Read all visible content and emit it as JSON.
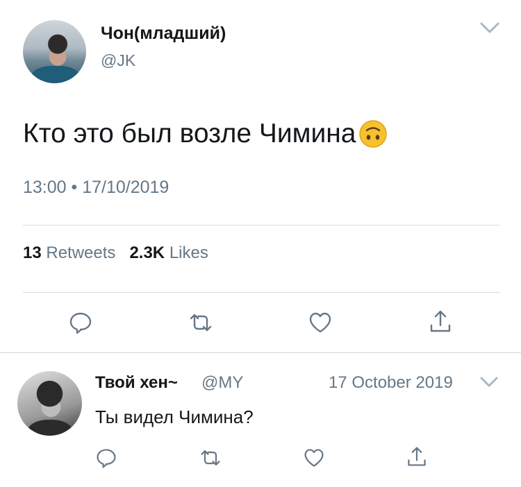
{
  "tweet": {
    "author_name": "Чон(младший)",
    "author_handle": "@JK",
    "text": "Кто это был возле Чимина",
    "emoji": "upside-down-face-icon",
    "meta": "13:00 • 17/10/2019",
    "retweets_count": "13",
    "retweets_label": "Retweets",
    "likes_count": "2.3K",
    "likes_label": "Likes"
  },
  "reply": {
    "author_name": "Твой хен~",
    "author_handle": "@MY",
    "date": "17 October 2019",
    "text": "Ты видел Чимина?"
  },
  "icons": [
    "reply-icon",
    "retweet-icon",
    "like-icon",
    "share-icon",
    "chevron-down-icon"
  ],
  "colors": {
    "secondary_text": "#657786",
    "divider": "#dcdcdc",
    "icon": "#657786",
    "chevron": "#aab8c2"
  }
}
